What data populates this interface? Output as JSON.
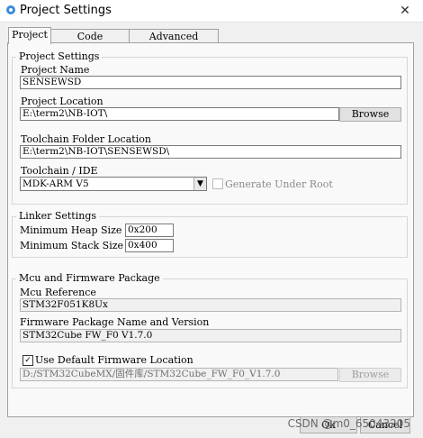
{
  "window": {
    "title": "Project Settings",
    "close_glyph": "✕",
    "icon": "app-icon"
  },
  "tabs": [
    {
      "label": "Project",
      "active": true
    },
    {
      "label": "Code Generator",
      "active": false
    },
    {
      "label": "Advanced Settings",
      "active": false
    }
  ],
  "project_settings": {
    "group_title": "Project Settings",
    "project_name_label": "Project Name",
    "project_name_value": "SENSEWSD",
    "project_location_label": "Project Location",
    "project_location_value": "E:\\term2\\NB-IOT\\",
    "browse_label": "Browse",
    "toolchain_folder_label": "Toolchain Folder Location",
    "toolchain_folder_value": "E:\\term2\\NB-IOT\\SENSEWSD\\",
    "toolchain_ide_label": "Toolchain / IDE",
    "toolchain_ide_value": "MDK-ARM V5",
    "generate_under_root_label": "Generate Under Root",
    "generate_under_root_checked": false
  },
  "linker_settings": {
    "group_title": "Linker Settings",
    "min_heap_label": "Minimum Heap Size",
    "min_heap_value": "0x200",
    "min_stack_label": "Minimum Stack Size",
    "min_stack_value": "0x400"
  },
  "mcu_firmware": {
    "group_title": "Mcu and Firmware Package",
    "mcu_reference_label": "Mcu Reference",
    "mcu_reference_value": "STM32F051K8Ux",
    "firmware_package_label": "Firmware Package Name and Version",
    "firmware_package_value": "STM32Cube FW_F0 V1.7.0",
    "use_default_location_label": "Use Default Firmware Location",
    "use_default_location_checked": true,
    "check_glyph": "✓",
    "firmware_location_value": "D:/STM32CubeMX/固件库/STM32Cube_FW_F0_V1.7.0",
    "browse_label": "Browse"
  },
  "footer": {
    "ok_label": "Ok",
    "cancel_label": "Cancel",
    "watermark": "CSDN @m0_65043205"
  },
  "icons": {
    "dropdown": "▼"
  },
  "colors": {
    "window_bg": "#f0f0f0",
    "panel_bg": "#f9f9f9",
    "app_icon": "#3b8ad8"
  }
}
